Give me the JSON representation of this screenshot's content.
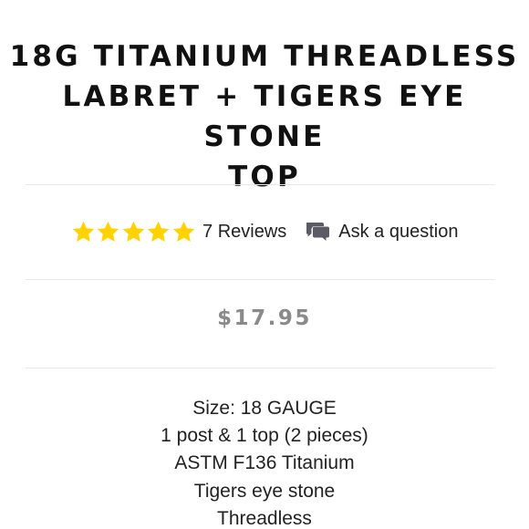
{
  "product": {
    "title_lines": [
      "18G TITANIUM THREADLESS",
      "LABRET + TIGERS EYE STONE",
      "TOP"
    ],
    "rating": {
      "stars": 5,
      "star_color": "#ffd200",
      "reviews_label": "7 Reviews"
    },
    "ask_question": {
      "label": "Ask a question",
      "icon": "chat-bubbles-icon"
    },
    "price": "$17.95",
    "specs": [
      "Size: 18 GAUGE",
      "1 post & 1 top (2 pieces)",
      "ASTM F136 Titanium",
      "Tigers eye stone",
      "Threadless"
    ]
  }
}
